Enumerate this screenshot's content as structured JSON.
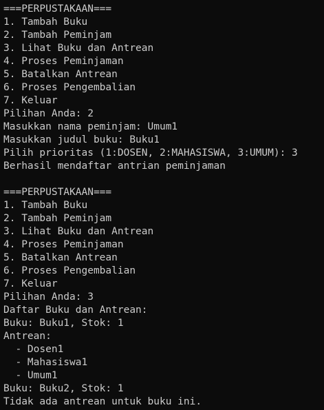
{
  "colors": {
    "background": "#0c0c0c",
    "foreground": "#cccccc"
  },
  "terminal": {
    "lines": [
      "===PERPUSTAKAAN===",
      "1. Tambah Buku",
      "2. Tambah Peminjam",
      "3. Lihat Buku dan Antrean",
      "4. Proses Peminjaman",
      "5. Batalkan Antrean",
      "6. Proses Pengembalian",
      "7. Keluar",
      "Pilihan Anda: 2",
      "Masukkan nama peminjam: Umum1",
      "Masukkan judul buku: Buku1",
      "Pilih prioritas (1:DOSEN, 2:MAHASISWA, 3:UMUM): 3",
      "Berhasil mendaftar antrian peminjaman",
      "",
      "===PERPUSTAKAAN===",
      "1. Tambah Buku",
      "2. Tambah Peminjam",
      "3. Lihat Buku dan Antrean",
      "4. Proses Peminjaman",
      "5. Batalkan Antrean",
      "6. Proses Pengembalian",
      "7. Keluar",
      "Pilihan Anda: 3",
      "Daftar Buku dan Antrean:",
      "Buku: Buku1, Stok: 1",
      "Antrean:",
      "  - Dosen1",
      "  - Mahasiswa1",
      "  - Umum1",
      "Buku: Buku2, Stok: 1",
      "Tidak ada antrean untuk buku ini."
    ]
  }
}
